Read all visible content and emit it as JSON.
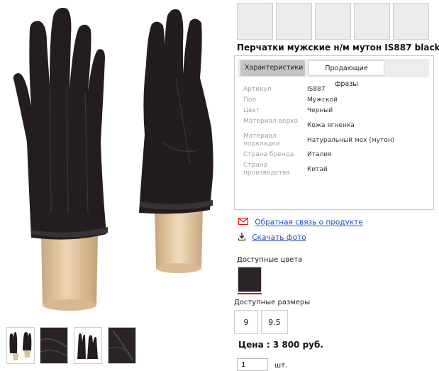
{
  "product": {
    "title": "Перчатки мужские н/м мутон IS887 black",
    "tabs": [
      "Характеристики",
      "Продающие фразы"
    ],
    "properties": [
      {
        "key": "Артикул",
        "value": "IS887"
      },
      {
        "key": "Пол",
        "value": "Мужской"
      },
      {
        "key": "Цвет",
        "value": "Черный"
      },
      {
        "key": "Материал верха",
        "value": "Кожа ягненка"
      },
      {
        "key": "Материал подкладки",
        "value": "Натуральный мех (мутон)"
      },
      {
        "key": "Страна бренда",
        "value": "Италия"
      },
      {
        "key": "Страна производства",
        "value": "Китай"
      }
    ]
  },
  "links": {
    "feedback": "Обратная связь о продукте",
    "download": "Скачать фото"
  },
  "colors": {
    "label": "Доступные цвета",
    "selected_swatch": "#2a2327",
    "accent": "#d41b1b",
    "link": "#1b4fbf"
  },
  "sizes": {
    "label": "Доступные размеры",
    "options": [
      "9",
      "9.5"
    ]
  },
  "price": "Цена : 3 800 руб.",
  "quantity": {
    "value": "1",
    "unit": "шт."
  },
  "icons": {
    "feedback": "mail-icon",
    "download": "download-icon"
  }
}
